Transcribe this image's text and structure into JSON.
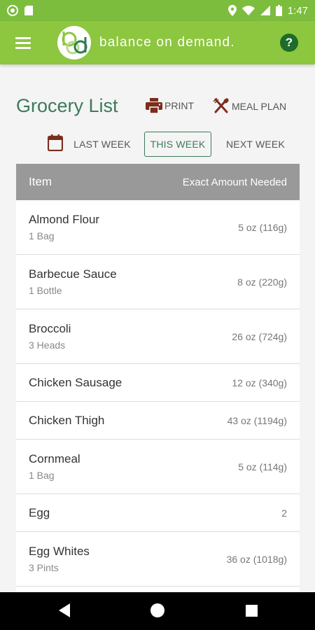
{
  "status": {
    "time": "1:47"
  },
  "appbar": {
    "brand": "balance on demand.",
    "logo_text": "bod",
    "help_label": "?"
  },
  "header": {
    "title": "Grocery List",
    "print_label": "PRINT",
    "meal_plan_label": "MEAL PLAN"
  },
  "weeks": {
    "last": "LAST WEEK",
    "this": "THIS WEEK",
    "next": "NEXT WEEK",
    "selected": "THIS WEEK"
  },
  "table": {
    "headers": {
      "item": "Item",
      "amount": "Exact Amount Needed"
    },
    "rows": [
      {
        "name": "Almond Flour",
        "unit": "1 Bag",
        "amount": "5 oz (116g)"
      },
      {
        "name": "Barbecue Sauce",
        "unit": "1 Bottle",
        "amount": "8 oz (220g)"
      },
      {
        "name": "Broccoli",
        "unit": "3 Heads",
        "amount": "26 oz (724g)"
      },
      {
        "name": "Chicken Sausage",
        "unit": "",
        "amount": "12 oz (340g)"
      },
      {
        "name": "Chicken Thigh",
        "unit": "",
        "amount": "43 oz (1194g)"
      },
      {
        "name": "Cornmeal",
        "unit": "1 Bag",
        "amount": "5 oz (114g)"
      },
      {
        "name": "Egg",
        "unit": "",
        "amount": "2"
      },
      {
        "name": "Egg Whites",
        "unit": "3 Pints",
        "amount": "36 oz (1018g)"
      }
    ]
  },
  "colors": {
    "appbar": "#8dc63f",
    "accent": "#3d7a5a",
    "icon_brown": "#7b2e1e",
    "table_header": "#999999"
  },
  "icons": [
    "menu-icon",
    "help-icon",
    "printer-icon",
    "fork-knife-icon",
    "calendar-icon",
    "back-icon",
    "home-icon",
    "recents-icon"
  ]
}
